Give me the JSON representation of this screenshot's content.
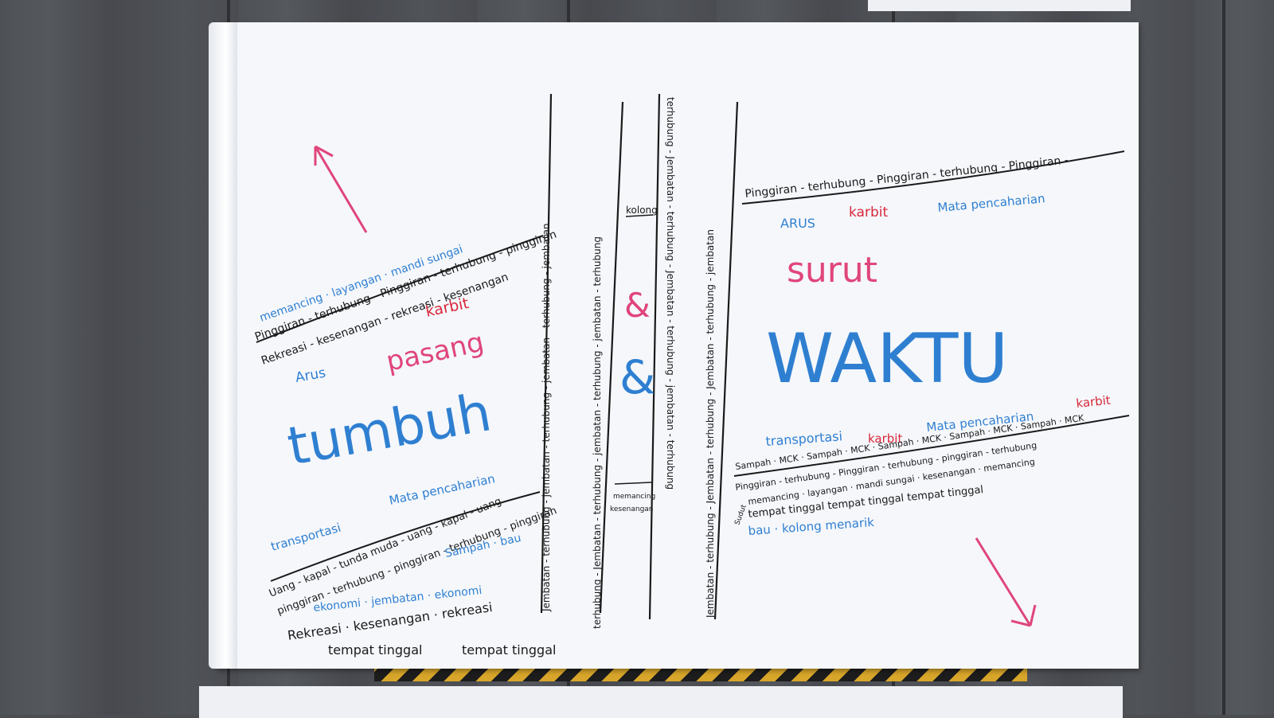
{
  "colors": {
    "ink_black": "#1a1a1a",
    "ink_blue": "#2f7fd1",
    "ink_pink": "#e0457a",
    "ink_red": "#d8283a"
  },
  "left": {
    "line1": "memancing · layangan · mandi sungai",
    "line2": "Pinggiran - terhubung - Pinggiran - terhubung - pinggiran",
    "line3": "Rekreasi - kesenangan - rekreasi - kesenangan",
    "karbit": "karbit",
    "pasang": "pasang",
    "arus": "Arus",
    "tumbuh": "tumbuh",
    "mata_pencaharian": "Mata pencaharian",
    "transportasi": "transportasi",
    "kapal_line": "Uang - kapal - tunda muda - uang - kapal - uang",
    "pinggiran_line": "pinggiran - terhubung - pinggiran - terhubung - pinggiran",
    "sampah": "Sampah · bau",
    "ekonomi": "ekonomi · jembatan · ekonomi",
    "rekreasi": "Rekreasi · kesenangan · rekreasi",
    "tempat1": "tempat tinggal",
    "tempat2": "tempat tinggal"
  },
  "center": {
    "col1": "Jembatan - terhubung - jembatan - terhubung - jembatan - terhubung - jembatan",
    "col2": "terhubung - Jembatan - terhubung - jembatan - terhubung - jembatan - terhubung",
    "kolong": "kolong",
    "amp1": "&",
    "amp2": "&",
    "memancing": "memancing",
    "kesenangan": "kesenangan",
    "col3": "terhubung - Jembatan - terhubung - Jembatan - terhubung - jembatan - terhubung",
    "col4": "Jembatan - terhubung - Jembatan - terhubung - Jembatan - terhubung - jembatan"
  },
  "right": {
    "top_line": "Pinggiran - terhubung - Pinggiran - terhubung - Pinggiran -",
    "arus": "ARUS",
    "karbit": "karbit",
    "mata": "Mata pencaharian",
    "surut": "surut",
    "waktu": "WAKTU",
    "transportasi": "transportasi",
    "karbit2": "karbit",
    "mata2": "Mata pencaharian",
    "karbit3": "karbit",
    "sampah_line": "Sampah · MCK · Sampah · MCK · Sampah · MCK · Sampah · MCK · Sampah · MCK",
    "pinggiran_line": "Pinggiran - terhubung - Pinggiran - terhubung - pinggiran - terhubung",
    "memancing_line": "memancing · layangan · mandi sungai · kesenangan · memancing",
    "sudut": "Sudut",
    "tempat_line": "tempat tinggal    tempat tinggal    tempat tinggal",
    "bau": "bau · kolong menarik"
  }
}
